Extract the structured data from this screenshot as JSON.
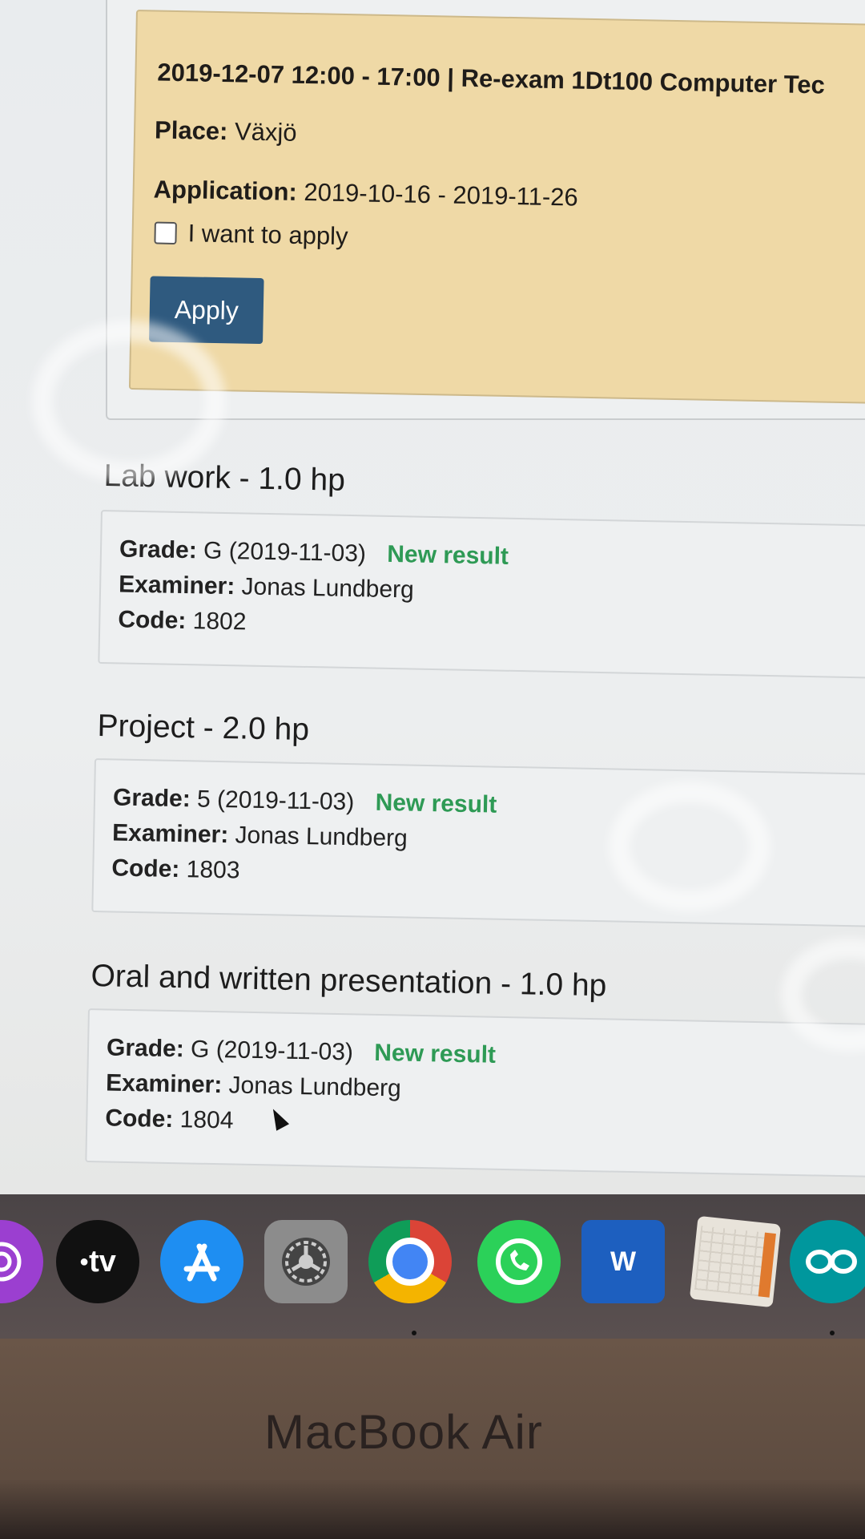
{
  "exam": {
    "title": "2019-12-07 12:00 - 17:00 | Re-exam 1Dt100 Computer Tec",
    "place_label": "Place:",
    "place_value": "Växjö",
    "application_label": "Application:",
    "application_value": "2019-10-16 - 2019-11-26",
    "checkbox_label": "I want to apply",
    "apply_button": "Apply"
  },
  "modules": [
    {
      "title": "Lab work - 1.0 hp",
      "grade_label": "Grade:",
      "grade_value": "G (2019-11-03)",
      "status": "New result",
      "examiner_label": "Examiner:",
      "examiner_value": "Jonas Lundberg",
      "code_label": "Code:",
      "code_value": "1802"
    },
    {
      "title": "Project - 2.0 hp",
      "grade_label": "Grade:",
      "grade_value": "5 (2019-11-03)",
      "status": "New result",
      "examiner_label": "Examiner:",
      "examiner_value": "Jonas Lundberg",
      "code_label": "Code:",
      "code_value": "1803"
    },
    {
      "title": "Oral and written presentation - 1.0 hp",
      "grade_label": "Grade:",
      "grade_value": "G (2019-11-03)",
      "status": "New result",
      "examiner_label": "Examiner:",
      "examiner_value": "Jonas Lundberg",
      "code_label": "Code:",
      "code_value": "1804"
    }
  ],
  "dock": {
    "apps": [
      "podcasts-icon",
      "apple-tv-icon",
      "app-store-icon",
      "system-preferences-icon",
      "chrome-icon",
      "whatsapp-icon",
      "word-icon",
      "calendar-sheet-icon",
      "arduino-icon"
    ],
    "tv_label": "tv",
    "word_label": "W"
  },
  "hardware": {
    "brand": "MacBook Air"
  },
  "colors": {
    "exam_background": "#efd9a6",
    "apply_button": "#2f5a7f",
    "new_result": "#2e9a55"
  }
}
